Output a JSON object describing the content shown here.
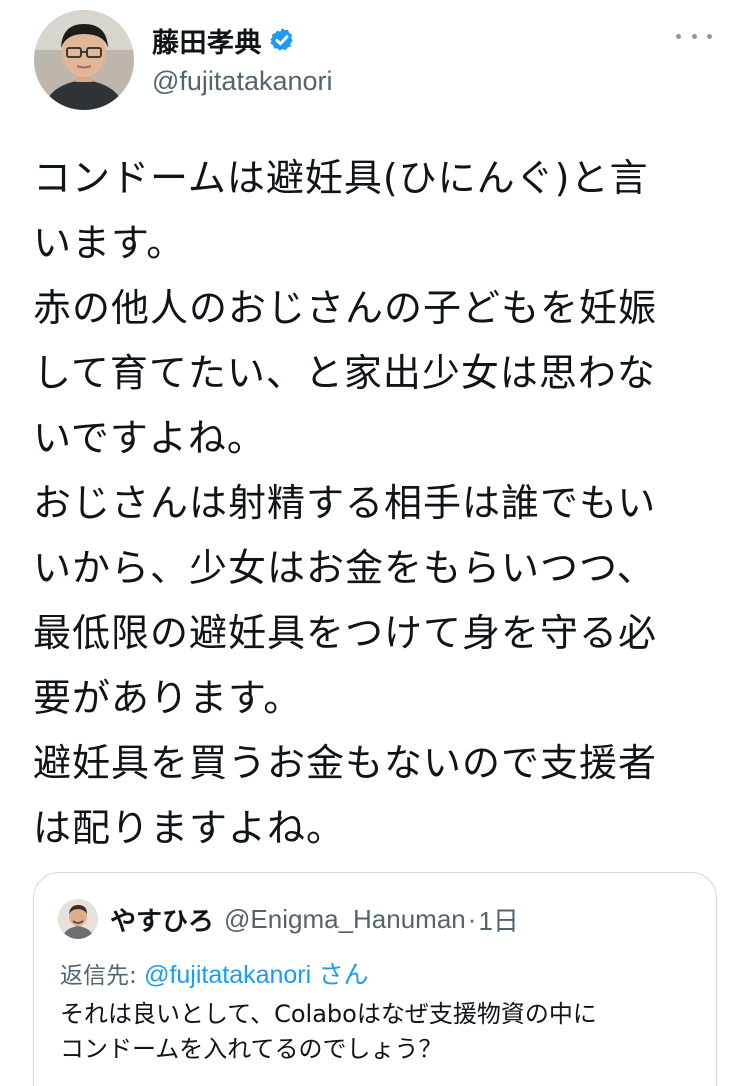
{
  "author": {
    "display_name": "藤田孝典",
    "handle": "@fujitatakanori",
    "verified": true,
    "avatar_icon": "profile-photo"
  },
  "actions": {
    "more_icon": "more-horizontal-icon"
  },
  "tweet": {
    "lines": [
      "コンドームは避妊具(ひにんぐ)と言",
      "います。",
      "赤の他人のおじさんの子どもを妊娠",
      "して育てたい、と家出少女は思わな",
      "いですよね。",
      "おじさんは射精する相手は誰でもい",
      "いから、少女はお金をもらいつつ、",
      "最低限の避妊具をつけて身を守る必",
      "要があります。",
      "避妊具を買うお金もないので支援者",
      "は配りますよね。"
    ]
  },
  "quoted_tweet": {
    "display_name": "やすひろ",
    "handle": "@Enigma_Hanuman",
    "separator": "·",
    "time": "1日",
    "reply_prefix": "返信先:",
    "reply_mention": "@fujitatakanori",
    "reply_suffix": "さん",
    "lines": [
      "それは良いとして、Colaboはなぜ支援物資の中に",
      "コンドームを入れてるのでしょう？"
    ]
  },
  "colors": {
    "accent": "#1d9bf0",
    "secondary_text": "#536471",
    "border": "#cfd9de"
  }
}
